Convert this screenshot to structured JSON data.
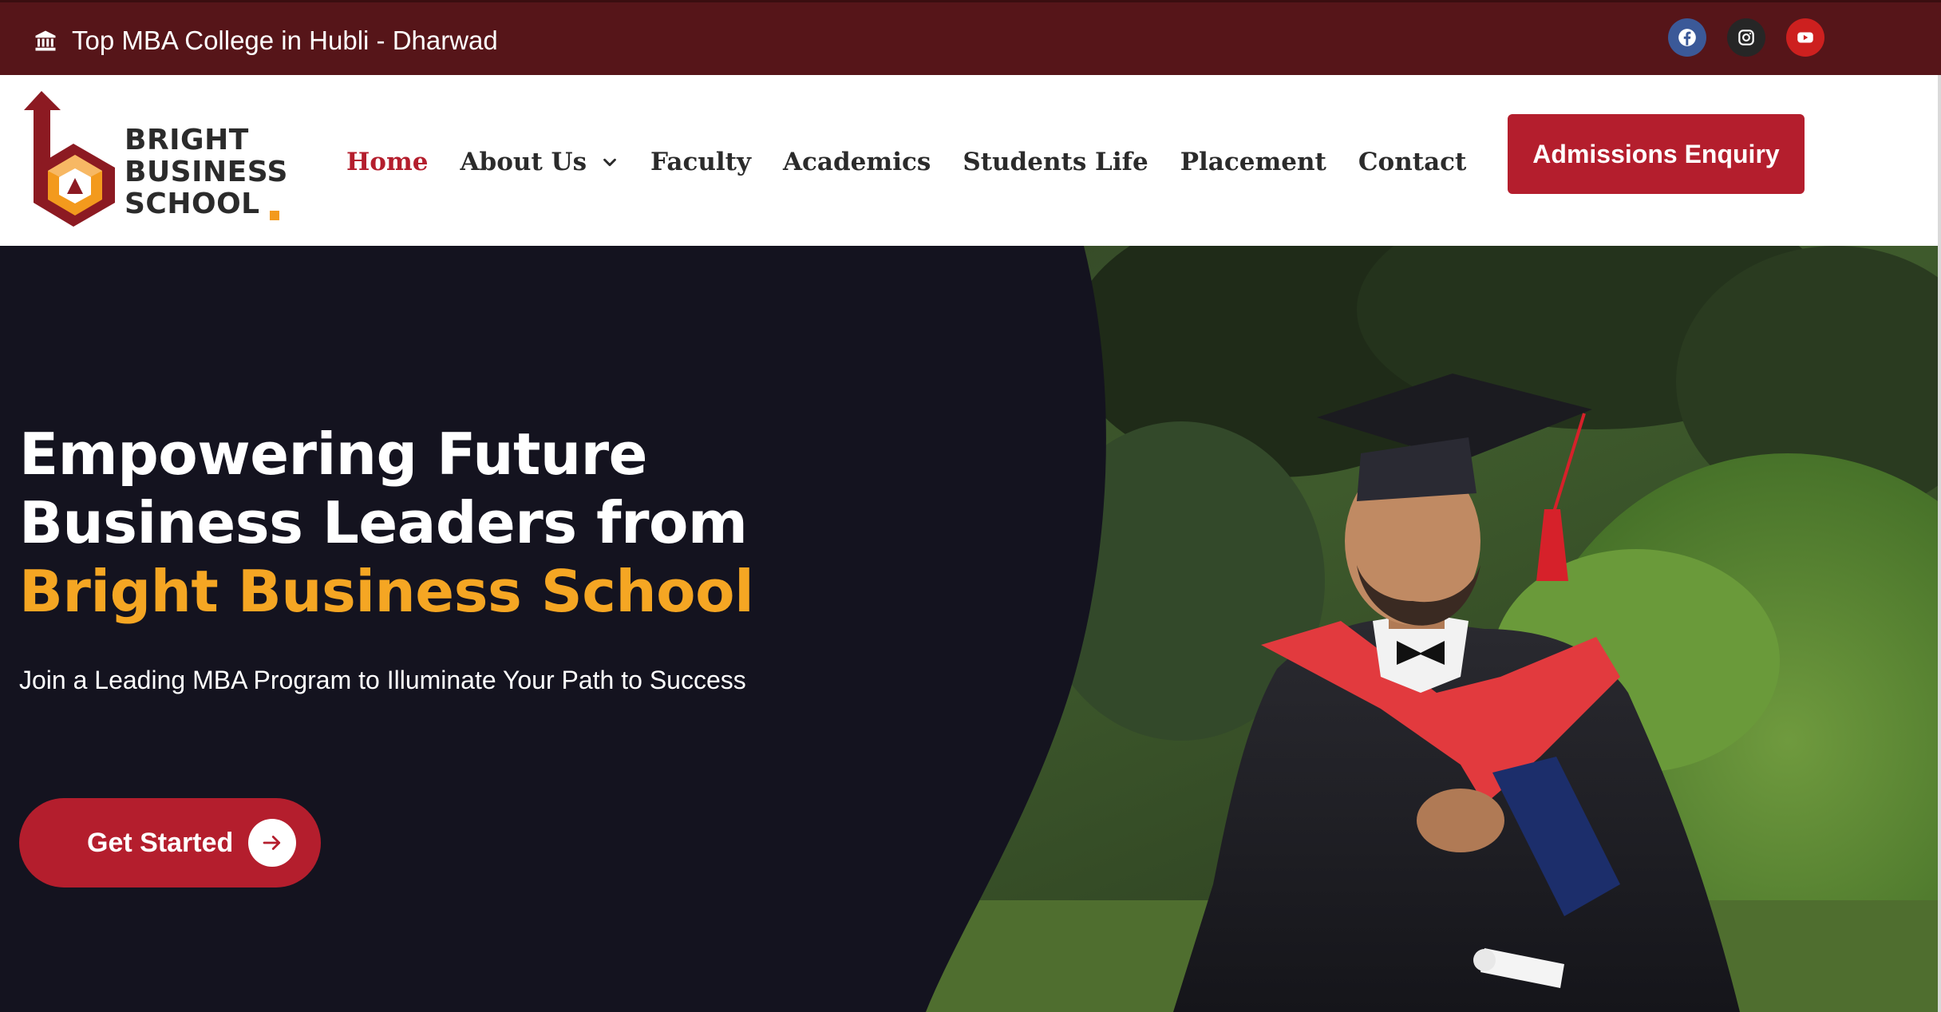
{
  "topbar": {
    "tagline": "Top MBA College in Hubli - Dharwad",
    "tagline_icon": "institution-icon",
    "social": [
      {
        "name": "facebook-icon",
        "color": "#3b5998"
      },
      {
        "name": "instagram-icon",
        "color": "#262626"
      },
      {
        "name": "youtube-icon",
        "color": "#cd201f"
      }
    ],
    "background": "#561519"
  },
  "logo": {
    "line1": "BRIGHT",
    "line2": "BUSINESS",
    "line3": "SCHOOL"
  },
  "nav": {
    "items": [
      {
        "label": "Home",
        "active": true
      },
      {
        "label": "About Us",
        "has_dropdown": true
      },
      {
        "label": "Faculty"
      },
      {
        "label": "Academics"
      },
      {
        "label": "Students Life"
      },
      {
        "label": "Placement"
      },
      {
        "label": "Contact"
      }
    ],
    "active_color": "#b41e2d"
  },
  "header": {
    "cta_label": "Admissions Enquiry",
    "cta_color": "#b41e2d"
  },
  "hero": {
    "title_line1": "Empowering Future",
    "title_line2": "Business Leaders from",
    "title_accent": "Bright Business School",
    "subtitle": "Join a Leading MBA Program to Illuminate Your Path to Success",
    "cta_label": "Get Started",
    "accent_color": "#f5a623",
    "dark_bg": "#14131f"
  }
}
